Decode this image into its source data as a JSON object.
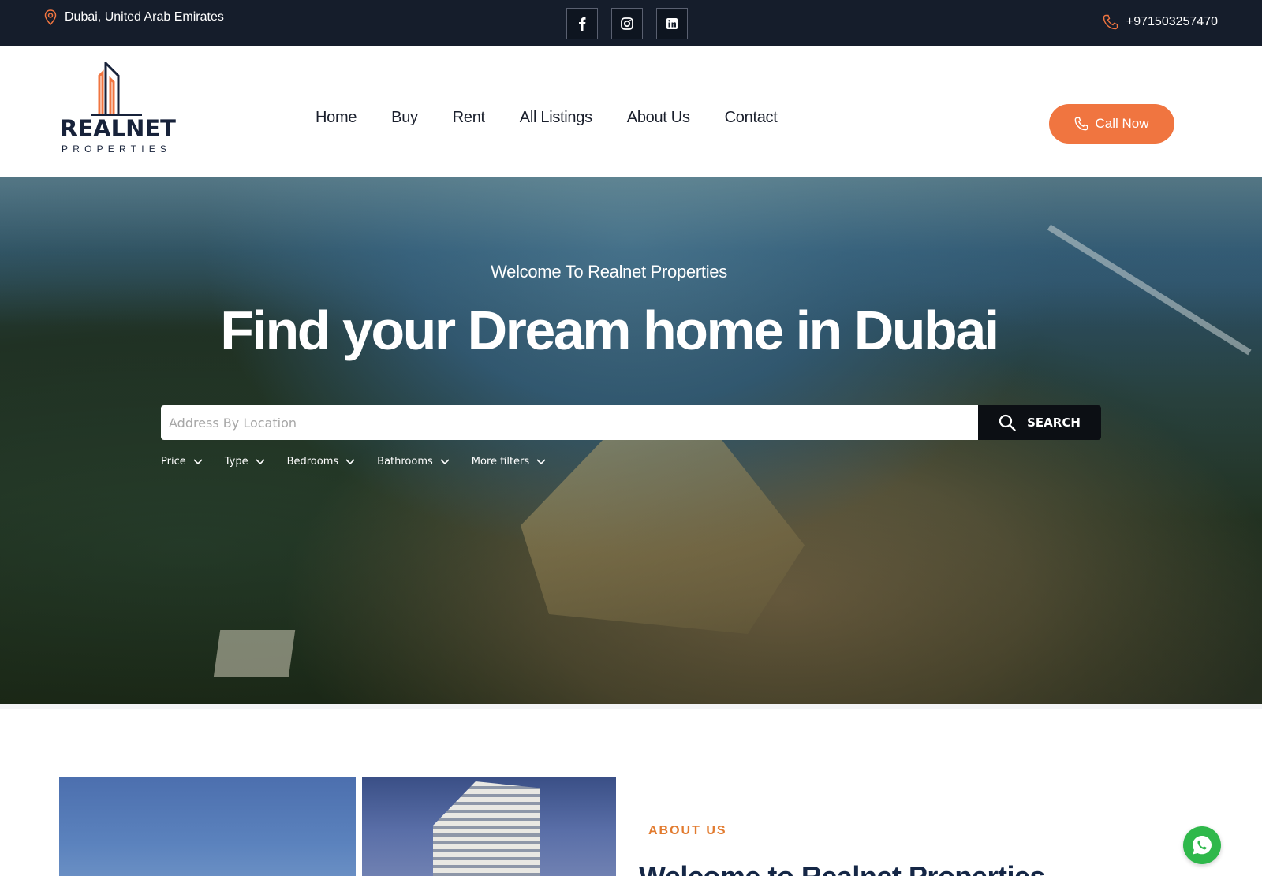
{
  "topbar": {
    "location": "Dubai, United Arab Emirates",
    "phone": "+971503257470",
    "socials": [
      {
        "name": "facebook-icon"
      },
      {
        "name": "instagram-icon"
      },
      {
        "name": "linkedin-icon"
      }
    ]
  },
  "header": {
    "logo_word": "REALNET",
    "logo_sub": "PROPERTIES",
    "nav": [
      "Home",
      "Buy",
      "Rent",
      "All Listings",
      "About Us",
      "Contact"
    ],
    "call_button": "Call Now"
  },
  "hero": {
    "subtitle": "Welcome To Realnet Properties",
    "title": "Find your Dream home in Dubai",
    "search": {
      "placeholder": "Address By Location",
      "value": "",
      "button": "SEARCH"
    },
    "filters": [
      "Price",
      "Type",
      "Bedrooms",
      "Bathrooms",
      "More filters"
    ]
  },
  "about": {
    "label": "ABOUT US",
    "title": "Welcome to Realnet Properties"
  },
  "colors": {
    "topbar_bg": "#151d2b",
    "accent_orange": "#f07540",
    "navy": "#17223a",
    "search_button_bg": "#0c0f14",
    "whatsapp_green": "#2fb84b"
  }
}
